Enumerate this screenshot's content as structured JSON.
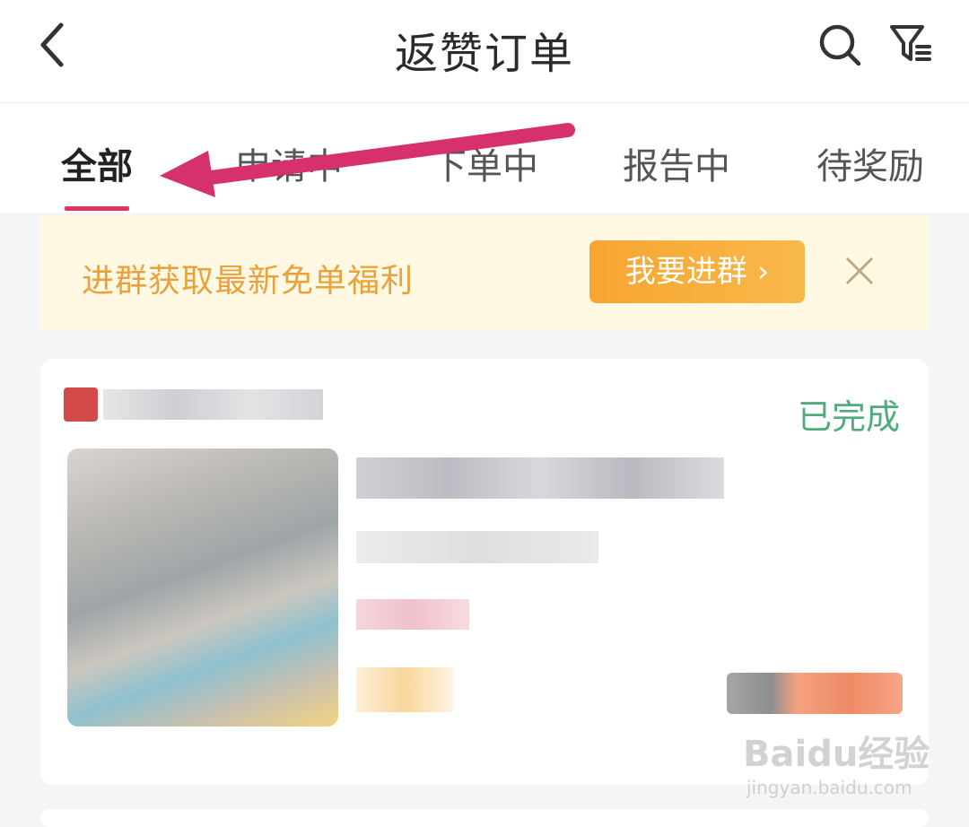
{
  "header": {
    "title": "返赞订单",
    "back_icon": "chevron-left-icon",
    "search_icon": "search-icon",
    "filter_icon": "filter-icon"
  },
  "tabs": [
    {
      "label": "全部",
      "active": true
    },
    {
      "label": "申请中",
      "active": false
    },
    {
      "label": "下单中",
      "active": false
    },
    {
      "label": "报告中",
      "active": false
    },
    {
      "label": "待奖励",
      "active": false
    }
  ],
  "banner": {
    "text": "进群获取最新免单福利",
    "button_label": "我要进群 ›",
    "close_icon": "close-icon"
  },
  "order": {
    "status": "已完成"
  },
  "watermark": {
    "brand": "Baidu经验",
    "url": "jingyan.baidu.com"
  },
  "colors": {
    "accent": "#e2335b",
    "banner_bg": "#fff8e3",
    "banner_text": "#e9a23b",
    "button": "#f7a531",
    "status_done": "#4ead7b"
  }
}
